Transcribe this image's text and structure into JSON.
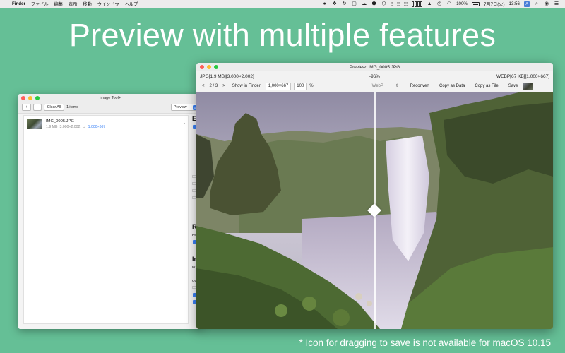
{
  "menubar": {
    "apple": "",
    "app_name": "Finder",
    "menus": [
      "ファイル",
      "編集",
      "表示",
      "移動",
      "ウインドウ",
      "ヘルプ"
    ],
    "battery": "100%",
    "date_time": "7月7日(火)",
    "clock": "13:56",
    "input_badge": "A"
  },
  "headline": "Preview with multiple features",
  "footnote": "* Icon for dragging to save is not available for macOS 10.15",
  "main_window": {
    "title": "Image Tool+",
    "toolbar": {
      "add": "+",
      "remove": "-",
      "clear_all": "Clear All",
      "count": "1 items",
      "mode": "Preview"
    },
    "files": [
      {
        "name": "IMG_0005.JPG",
        "size": "1.9 MB",
        "dims": "3,000×2,002",
        "arrow": "→",
        "target": "1,000×667",
        "dash": "-"
      }
    ],
    "side_headings": [
      "E",
      "R",
      "In"
    ],
    "side_small": [
      "Re",
      "W",
      "Ou"
    ]
  },
  "preview_window": {
    "title": "Preview: IMG_0005.JPG",
    "left_info": "JPG[1.9 MB][3,000×2,002]",
    "center_info": "-96%",
    "right_info": "WEBP[67 KB][1,000×667]",
    "controls": {
      "prev": "<",
      "page": "2 / 3",
      "next": ">",
      "show_in_finder": "Show in Finder",
      "dims": "1,000×667",
      "quality": "100",
      "percent": "%",
      "format": "WebP",
      "reconvert": "Reconvert",
      "copy_data": "Copy as Data",
      "copy_file": "Copy as File",
      "save": "Save"
    }
  }
}
